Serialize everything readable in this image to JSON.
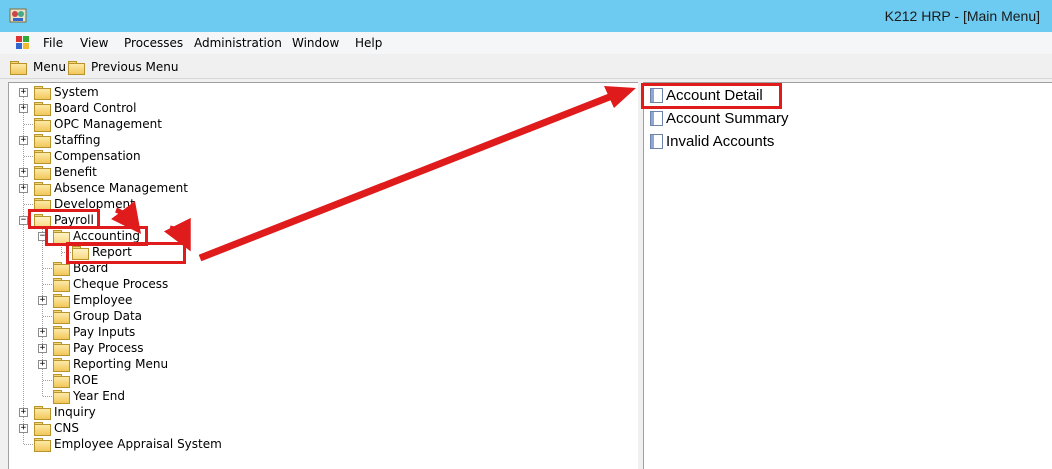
{
  "window": {
    "title": "K212 HRP - [Main Menu]",
    "icon": "hrp-app-icon"
  },
  "menubar": {
    "items": [
      "File",
      "View",
      "Processes",
      "Administration",
      "Window",
      "Help"
    ]
  },
  "toolbar": {
    "menu_label": "Menu",
    "previous_menu_label": "Previous Menu"
  },
  "tree": {
    "system": "System",
    "board_control": "Board Control",
    "opc_management": "OPC Management",
    "staffing": "Staffing",
    "compensation": "Compensation",
    "benefit": "Benefit",
    "absence_management": "Absence Management",
    "development": "Development",
    "payroll": "Payroll",
    "accounting": "Accounting",
    "report": "Report",
    "board": "Board",
    "cheque_process": "Cheque Process",
    "employee": "Employee",
    "group_data": "Group Data",
    "pay_inputs": "Pay Inputs",
    "pay_process": "Pay Process",
    "reporting_menu": "Reporting Menu",
    "roe": "ROE",
    "year_end": "Year End",
    "inquiry": "Inquiry",
    "cns": "CNS",
    "employee_appraisal_system": "Employee Appraisal System"
  },
  "reports": {
    "items": [
      "Account Detail",
      "Account Summary",
      "Invalid Accounts"
    ]
  },
  "colors": {
    "annotation": "#e01b1b",
    "titlebar": "#6dcaf0"
  }
}
